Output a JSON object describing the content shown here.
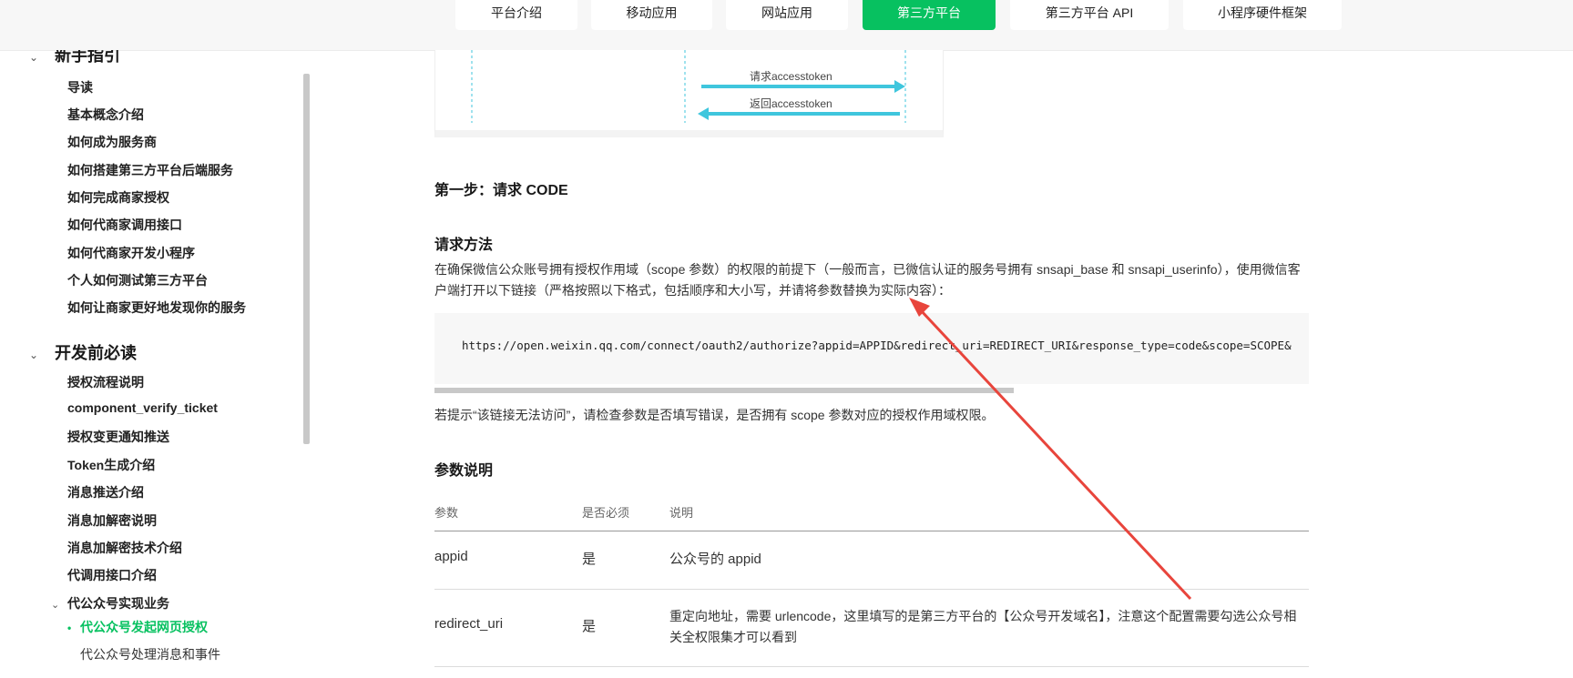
{
  "topnav": {
    "tabs": [
      {
        "label": "平台介绍"
      },
      {
        "label": "移动应用"
      },
      {
        "label": "网站应用"
      },
      {
        "label": "第三方平台",
        "active": true
      },
      {
        "label": "第三方平台 API"
      },
      {
        "label": "小程序硬件框架"
      }
    ],
    "active_color": "#07c160"
  },
  "sidebar": {
    "section1": {
      "title": "新手指引",
      "items": [
        "导读",
        "基本概念介绍",
        "如何成为服务商",
        "如何搭建第三方平台后端服务",
        "如何完成商家授权",
        "如何代商家调用接口",
        "如何代商家开发小程序",
        "个人如何测试第三方平台",
        "如何让商家更好地发现你的服务"
      ]
    },
    "section2": {
      "title": "开发前必读",
      "items": [
        "授权流程说明",
        "component_verify_ticket",
        "授权变更通知推送",
        "Token生成介绍",
        "消息推送介绍",
        "消息加解密说明",
        "消息加解密技术介绍",
        "代调用接口介绍"
      ]
    },
    "subsection": {
      "title": "代公众号实现业务",
      "active_item": "代公众号发起网页授权",
      "next_item": "代公众号处理消息和事件"
    }
  },
  "diagram": {
    "arrow_request": "请求accesstoken",
    "arrow_response": "返回accesstoken",
    "arrow_color": "#3fc6dd"
  },
  "content": {
    "step_title": "第一步：请求 CODE",
    "method_title": "请求方法",
    "method_desc": "在确保微信公众账号拥有授权作用域（scope 参数）的权限的前提下（一般而言，已微信认证的服务号拥有 snsapi_base 和 snsapi_userinfo），使用微信客户端打开以下链接（严格按照以下格式，包括顺序和大小写，并请将参数替换为实际内容）：",
    "code_url": "https://open.weixin.qq.com/connect/oauth2/authorize?appid=APPID&redirect_uri=REDIRECT_URI&response_type=code&scope=SCOPE&",
    "hint": "若提示“该链接无法访问”，请检查参数是否填写错误，是否拥有 scope 参数对应的授权作用域权限。",
    "params_title": "参数说明",
    "table": {
      "headers": [
        "参数",
        "是否必须",
        "说明"
      ],
      "rows": [
        {
          "param": "appid",
          "required": "是",
          "desc": "公众号的 appid"
        },
        {
          "param": "redirect_uri",
          "required": "是",
          "desc": "重定向地址，需要 urlencode，这里填写的是第三方平台的【公众号开发域名】，注意这个配置需要勾选公众号相关全权限集才可以看到"
        }
      ]
    }
  },
  "annotation": {
    "color": "#e8453c"
  }
}
